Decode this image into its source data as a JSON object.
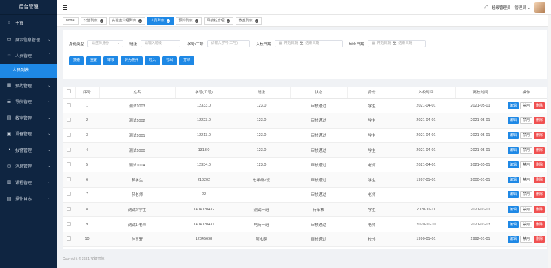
{
  "app": {
    "title": "后台管理"
  },
  "sidebar": {
    "items": [
      {
        "label": "主页",
        "icon": "home-icon",
        "chev": false
      },
      {
        "label": "展示信息管理",
        "icon": "display-icon",
        "chev": true
      },
      {
        "label": "人员管理",
        "icon": "user-icon",
        "chev": true,
        "open": true
      }
    ],
    "sub_active": "人员列表",
    "items_after": [
      {
        "label": "预约管理",
        "icon": "calendar-icon"
      },
      {
        "label": "导航管理",
        "icon": "nav-icon"
      },
      {
        "label": "教室管理",
        "icon": "classroom-icon"
      },
      {
        "label": "设备管理",
        "icon": "device-icon"
      },
      {
        "label": "报警管理",
        "icon": "alarm-icon"
      },
      {
        "label": "消息管理",
        "icon": "message-icon"
      },
      {
        "label": "课程管理",
        "icon": "course-icon"
      },
      {
        "label": "操作日志",
        "icon": "log-icon"
      }
    ]
  },
  "header": {
    "user_role": "超级管理员",
    "user_name": "管理员"
  },
  "tabs": [
    {
      "label": "home",
      "active": false,
      "closable": false
    },
    {
      "label": "公告列表",
      "active": false,
      "closable": true
    },
    {
      "label": "实验室介绍列表",
      "active": false,
      "closable": true
    },
    {
      "label": "人员列表",
      "active": true,
      "closable": true
    },
    {
      "label": "预约列表",
      "active": false,
      "closable": true
    },
    {
      "label": "导航栏管理",
      "active": false,
      "closable": true
    },
    {
      "label": "教室列表",
      "active": false,
      "closable": true
    }
  ],
  "filters": {
    "identity_label": "身份类型",
    "identity_placeholder": "请选择身份",
    "class_label": "班级",
    "class_placeholder": "请输入班级",
    "id_label": "学号/工号",
    "id_placeholder": "请输入学号(工号)",
    "enroll_label": "入校日期",
    "grad_label": "毕业日期",
    "start_placeholder": "开始日期",
    "end_placeholder": "结束日期",
    "date_sep": "至"
  },
  "buttons": [
    "搜索",
    "重置",
    "审核",
    "转为校外",
    "导入",
    "导出",
    "打印"
  ],
  "table": {
    "headers": [
      "序号",
      "姓名",
      "学号(工号)",
      "班级",
      "状态",
      "身份",
      "入校时间",
      "离校时间",
      "操作"
    ],
    "op_labels": {
      "edit": "编辑",
      "disable": "禁用",
      "delete": "删除"
    },
    "rows": [
      [
        "1",
        "测试1003",
        "12333.0",
        "123.0",
        "审核通过",
        "学生",
        "2021-04-01",
        "2021-05-01"
      ],
      [
        "2",
        "测试1002",
        "12223.0",
        "123.0",
        "审核通过",
        "学生",
        "2021-04-01",
        "2021-05-01"
      ],
      [
        "3",
        "测试1001",
        "12213.0",
        "123.0",
        "审核通过",
        "学生",
        "2021-04-01",
        "2021-05-01"
      ],
      [
        "4",
        "测试1000",
        "1313.0",
        "123.0",
        "审核通过",
        "学生",
        "2021-04-01",
        "2021-05-01"
      ],
      [
        "5",
        "测试1004",
        "12334.0",
        "123.0",
        "审核通过",
        "老师",
        "2021-04-01",
        "2021-05-01"
      ],
      [
        "6",
        "郝学生",
        "213202",
        "七年级2班",
        "审核通过",
        "学生",
        "1997-01-01",
        "2000-01-01"
      ],
      [
        "7",
        "郝老师",
        "22",
        "",
        "审核通过",
        "老师",
        "",
        ""
      ],
      [
        "8",
        "测试2 学生",
        "1404020432",
        "测试一班",
        "待审核",
        "学生",
        "2020-11-11",
        "2021-03-01"
      ],
      [
        "9",
        "测试1 老师",
        "1404020431",
        "电商一班",
        "审核通过",
        "老师",
        "2020-10-10",
        "2021-03-03"
      ],
      [
        "10",
        "孙玉轩",
        "12345698",
        "阿水啊",
        "审核通过",
        "校外",
        "1990-01-01",
        "1992-01-01"
      ]
    ]
  },
  "footer": {
    "text": "Copyright © 2021 安锦智信."
  }
}
